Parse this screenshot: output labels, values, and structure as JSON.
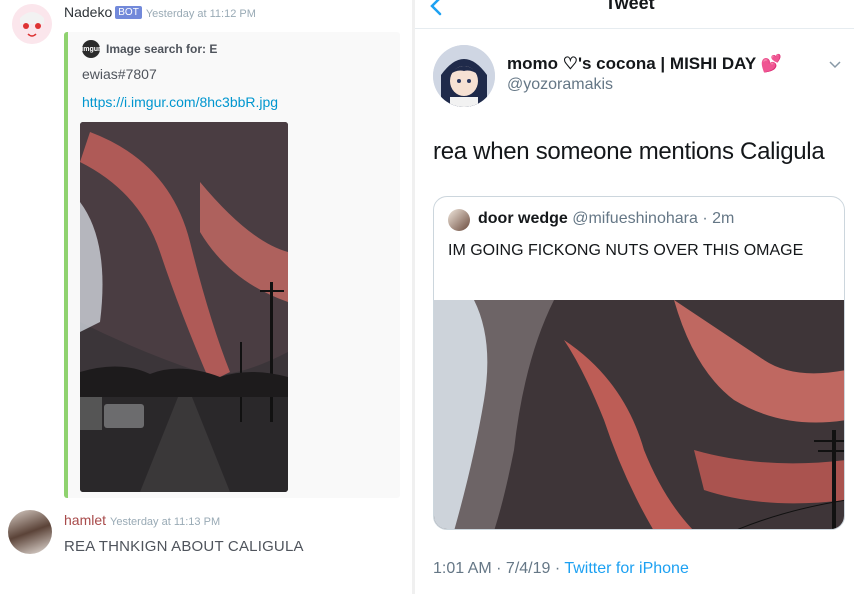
{
  "discord": {
    "bot_message": {
      "username": "Nadeko",
      "bot_tag": "BOT",
      "timestamp": "Yesterday at 11:12 PM",
      "embed": {
        "author_icon": "imgur",
        "author": "Image search for: E",
        "description": "ewias#7807",
        "link": "https://i.imgur.com/8hc3bbR.jpg"
      }
    },
    "user_message": {
      "username": "hamlet",
      "timestamp": "Yesterday at 11:13 PM",
      "text": "REA THNKIGN ABOUT CALIGULA"
    }
  },
  "twitter": {
    "header_title": "Tweet",
    "author_name": "momo ♡'s cocona | MISHI DAY 💕",
    "author_handle": "@yozoramakis",
    "tweet_text": "rea when someone mentions Caligula",
    "quoted": {
      "name": "door wedge",
      "meta": "@mifueshinohara · 2m",
      "text": "IM GOING FICKONG NUTS OVER THIS OMAGE"
    },
    "footer_time": "1:01 AM · 7/4/19 · ",
    "footer_source": "Twitter for iPhone"
  },
  "colors": {
    "bot_tag": "#7289da",
    "embed_accent": "#8fd26f",
    "link": "#0096cf",
    "twitter_blue": "#1da1f2"
  }
}
